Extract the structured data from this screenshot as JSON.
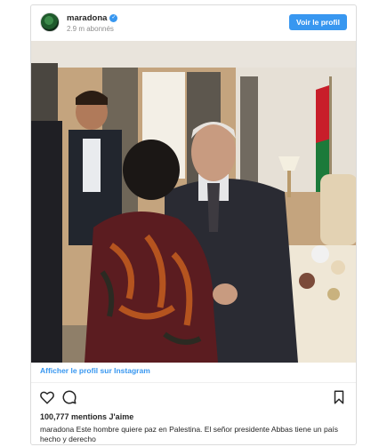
{
  "header": {
    "username": "maradona",
    "followers": "2.9 m abonnés",
    "view_profile_label": "Voir le profil"
  },
  "footer": {
    "profile_link": "Afficher le profil sur Instagram",
    "likes": "100,777 mentions J'aime",
    "caption_user": "maradona",
    "caption_text": "Este hombre quiere paz en Palestina. El señor presidente Abbas tiene un país hecho y derecho"
  },
  "icons": {
    "like": "heart-icon",
    "comment": "comment-icon",
    "save": "bookmark-icon",
    "verified": "verified-badge-icon"
  },
  "colors": {
    "accent": "#3897f0",
    "text": "#262626",
    "muted": "#8e8e8e",
    "border": "#dbdbdb"
  }
}
